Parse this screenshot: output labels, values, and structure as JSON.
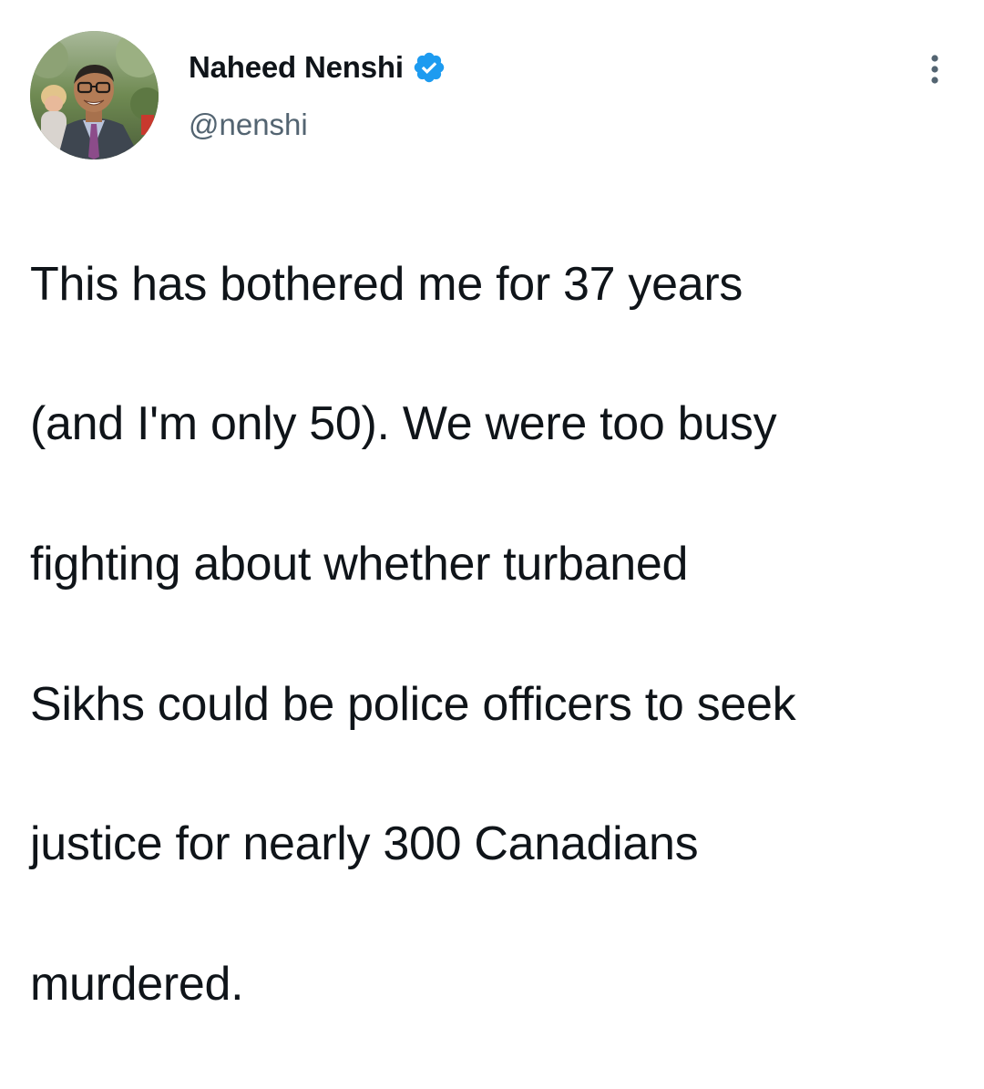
{
  "tweet": {
    "author": {
      "display_name": "Naheed Nenshi",
      "handle": "@nenshi",
      "verified": true,
      "avatar": "profile-photo"
    },
    "text_lines": [
      "This has bothered me for 37 years",
      "(and I'm only 50). We were too busy",
      "fighting about whether turbaned",
      "Sikhs could be police officers to seek",
      "justice for nearly 300 Canadians",
      "murdered."
    ],
    "icons": {
      "verified": "verified-badge-icon",
      "more": "more-options-icon"
    },
    "colors": {
      "text": "#0f1419",
      "secondary": "#536471",
      "verified_blue": "#1d9bf0"
    }
  }
}
